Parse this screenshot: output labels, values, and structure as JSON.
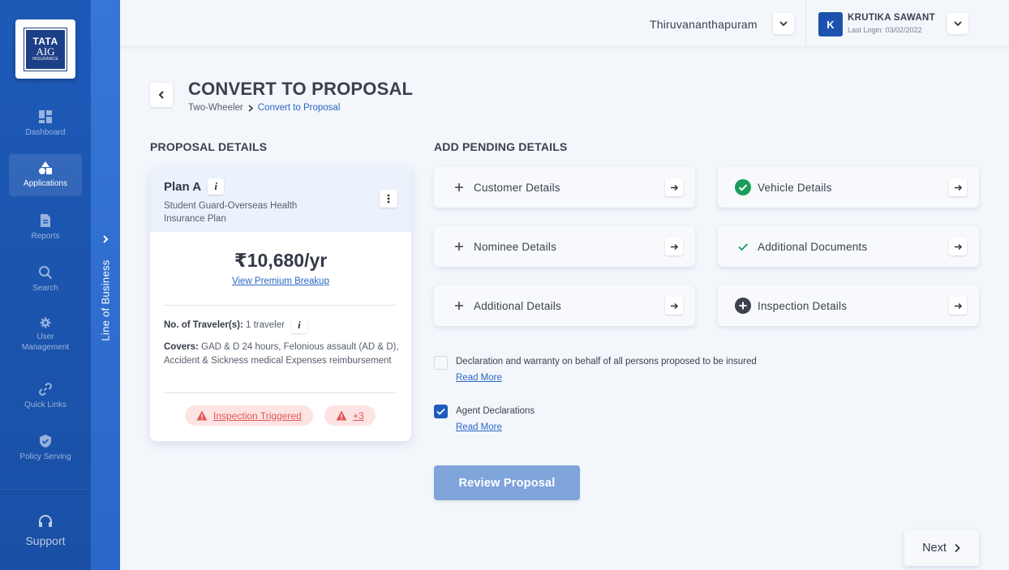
{
  "sidebar": {
    "logo": {
      "line1": "TATA",
      "line2": "AIG",
      "line3": "INSURANCE"
    },
    "items": [
      {
        "label": "Dashboard",
        "icon": "dashboard-icon"
      },
      {
        "label": "Applications",
        "icon": "applications-icon",
        "active": true
      },
      {
        "label": "Reports",
        "icon": "reports-icon"
      },
      {
        "label": "Search",
        "icon": "search-icon"
      },
      {
        "label": "User Management",
        "icon": "user-management-icon"
      },
      {
        "label": "Quick Links",
        "icon": "link-icon"
      },
      {
        "label": "Policy Serving",
        "icon": "shield-icon"
      }
    ],
    "support_label": "Support"
  },
  "lob": {
    "label": "Line of Business"
  },
  "topbar": {
    "location": "Thiruvananthapuram",
    "avatar_initial": "K",
    "user_name": "KRUTIKA SAWANT",
    "last_login": "Last Login: 03/02/2022"
  },
  "page": {
    "title": "CONVERT TO PROPOSAL",
    "breadcrumb": [
      "Two-Wheeler",
      "Convert to Proposal"
    ]
  },
  "proposal": {
    "heading": "PROPOSAL DETAILS",
    "plan_name": "Plan A",
    "plan_subtitle": "Student Guard-Overseas Health Insurance Plan",
    "price": "₹10,680/yr",
    "breakup_link": "View Premium Breakup",
    "travelers_label": "No. of Traveler(s):",
    "travelers_value": "1 traveler",
    "covers_label": "Covers:",
    "covers_value": "GAD & D 24 hours, Felonious assault (AD & D), Accident & Sickness medical Expenses reimbursement",
    "alert_label": "Inspection Triggered",
    "alert_more": "+3"
  },
  "pending": {
    "heading": "ADD PENDING DETAILS",
    "tiles": [
      {
        "label": "Customer Details",
        "status": "add"
      },
      {
        "label": "Vehicle Details",
        "status": "complete"
      },
      {
        "label": "Nominee Details",
        "status": "add"
      },
      {
        "label": "Additional Documents",
        "status": "check"
      },
      {
        "label": "Additional Details",
        "status": "add"
      },
      {
        "label": "Inspection Details",
        "status": "add-circle"
      }
    ]
  },
  "declarations": [
    {
      "label": "Declaration and warranty on behalf of all persons proposed to be insured",
      "link": "Read More",
      "checked": false
    },
    {
      "label": "Agent Declarations",
      "link": "Read More",
      "checked": true
    }
  ],
  "actions": {
    "review": "Review Proposal",
    "next": "Next"
  },
  "colors": {
    "primary": "#1d5ab8",
    "accent": "#2b67c4",
    "success": "#1a9c5b",
    "alert": "#e05757"
  }
}
